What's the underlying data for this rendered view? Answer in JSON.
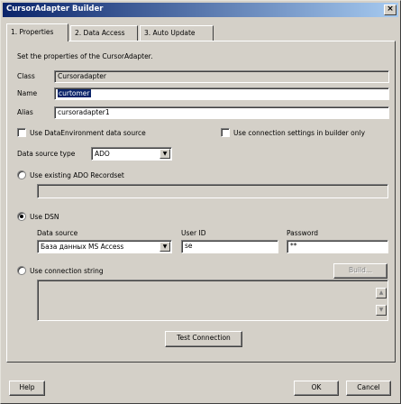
{
  "window": {
    "title": "CursorAdapter Builder",
    "close_glyph": "×"
  },
  "tabs": [
    {
      "label": "1. Properties"
    },
    {
      "label": "2. Data Access"
    },
    {
      "label": "3. Auto Update"
    }
  ],
  "properties": {
    "instruction": "Set the properties of the CursorAdapter.",
    "class_label": "Class",
    "class_value": "Cursoradapter",
    "name_label": "Name",
    "name_value": "curtomer",
    "alias_label": "Alias",
    "alias_value": "cursoradapter1",
    "use_dataenv_label": "Use DataEnvironment data source",
    "use_conn_builder_label": "Use connection settings in builder only",
    "data_source_type_label": "Data source type",
    "data_source_type_value": "ADO",
    "use_existing_ado_label": "Use existing ADO Recordset",
    "use_dsn_label": "Use DSN",
    "data_source_label": "Data source",
    "data_source_value": "База данных MS Access",
    "user_id_label": "User ID",
    "user_id_value": "se",
    "password_label": "Password",
    "password_value": "**",
    "use_conn_string_label": "Use connection string",
    "build_label": "Build...",
    "test_connection_label": "Test Connection"
  },
  "footer": {
    "help_label": "Help",
    "ok_label": "OK",
    "cancel_label": "Cancel"
  },
  "icons": {
    "combo_arrow": "▼",
    "scroll_up": "▲",
    "scroll_down": "▼"
  }
}
